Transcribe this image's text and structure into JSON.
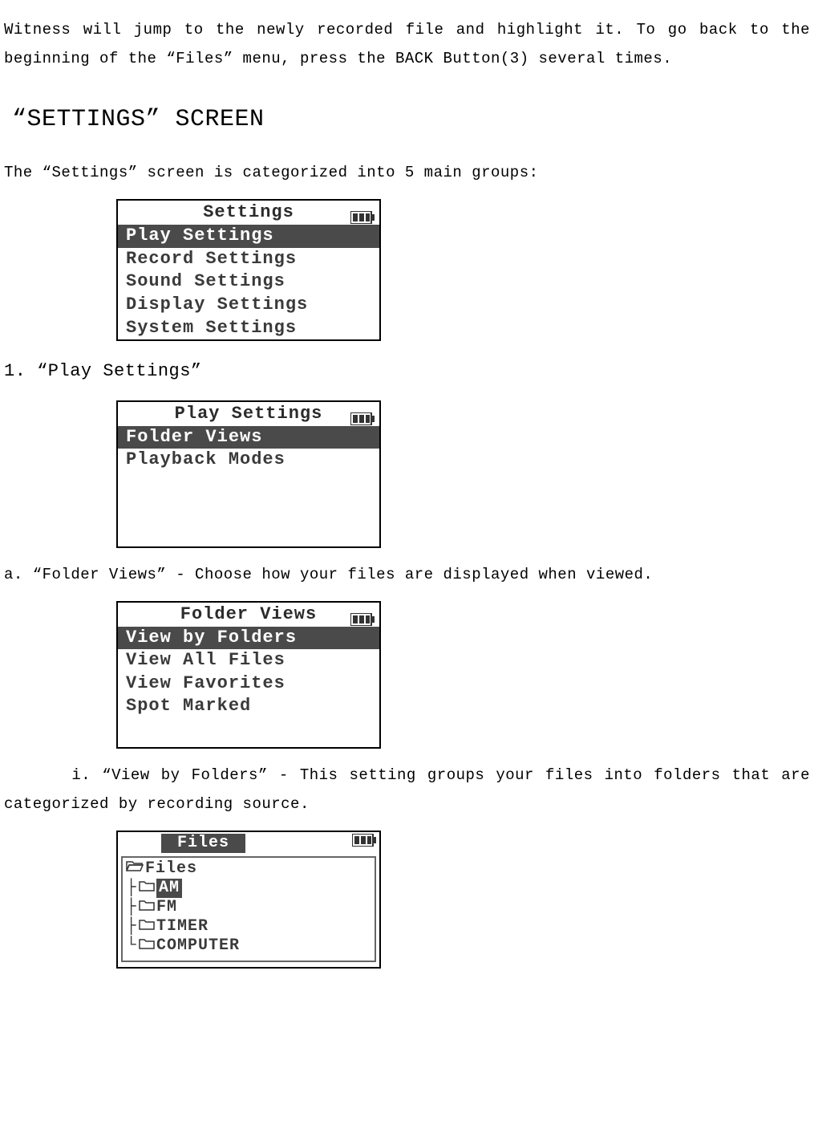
{
  "intro": "Witness will jump to the newly recorded file and highlight it. To go back to the beginning of the “Files” menu, press the BACK Button(3) several times.",
  "heading": "“SETTINGS” SCREEN",
  "desc": "The “Settings” screen is categorized into 5 main groups:",
  "screen1": {
    "title": "Settings",
    "items": [
      "Play Settings",
      "Record Settings",
      "Sound Settings",
      "Display Settings",
      "System Settings"
    ],
    "selected": 0
  },
  "sub1": "1. “Play Settings”",
  "screen2": {
    "title": "Play Settings",
    "items": [
      "Folder Views",
      "Playback Modes"
    ],
    "selected": 0
  },
  "sub2": "a. “Folder Views” - Choose how your files are displayed when viewed.",
  "screen3": {
    "title": "Folder Views",
    "items": [
      "View by Folders",
      "View All Files",
      "View Favorites",
      "Spot Marked"
    ],
    "selected": 0
  },
  "sub3": "      i. “View by Folders” - This setting groups your files into folders that are categorized by recording source.",
  "screen4": {
    "title": "Files",
    "root": "Files",
    "items": [
      "AM",
      "FM",
      "TIMER",
      "COMPUTER"
    ],
    "selected": 0
  }
}
